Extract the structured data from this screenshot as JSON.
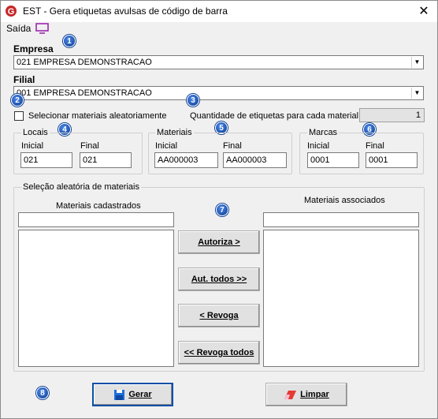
{
  "window": {
    "title": "EST - Gera etiquetas avulsas de código de barra",
    "close": "✕"
  },
  "menu": {
    "saida": "Saída"
  },
  "badges": [
    "1",
    "2",
    "3",
    "4",
    "5",
    "6",
    "7",
    "8"
  ],
  "empresa": {
    "label": "Empresa",
    "value": "021 EMPRESA DEMONSTRACAO"
  },
  "filial": {
    "label": "Filial",
    "value": "001 EMPRESA DEMONSTRACAO"
  },
  "random": {
    "checkbox_label": "Selecionar materiais aleatoriamente",
    "checked": false
  },
  "quantity": {
    "label": "Quantidade de etiquetas para cada material",
    "value": "1"
  },
  "locais": {
    "title": "Locais",
    "inicial_label": "Inicial",
    "final_label": "Final",
    "inicial": "021",
    "final": "021"
  },
  "materiais": {
    "title": "Materiais",
    "inicial_label": "Inicial",
    "final_label": "Final",
    "inicial": "AA000003",
    "final": "AA000003"
  },
  "marcas": {
    "title": "Marcas",
    "inicial_label": "Inicial",
    "final_label": "Final",
    "inicial": "0001",
    "final": "0001"
  },
  "selecao": {
    "title": "Seleção aleatória de materiais",
    "left_label": "Materiais cadastrados",
    "right_label": "Materiais associados",
    "left_filter": "",
    "right_filter": "",
    "buttons": {
      "autoriza": "Autoriza >",
      "aut_todos": "Aut. todos >>",
      "revoga": "< Revoga",
      "revoga_todos": "<< Revoga todos"
    }
  },
  "actions": {
    "gerar": "Gerar",
    "limpar": "Limpar"
  },
  "colors": {
    "badge": "#0b3d91",
    "accent": "#0a4fa8",
    "app_icon": "#c62828"
  }
}
